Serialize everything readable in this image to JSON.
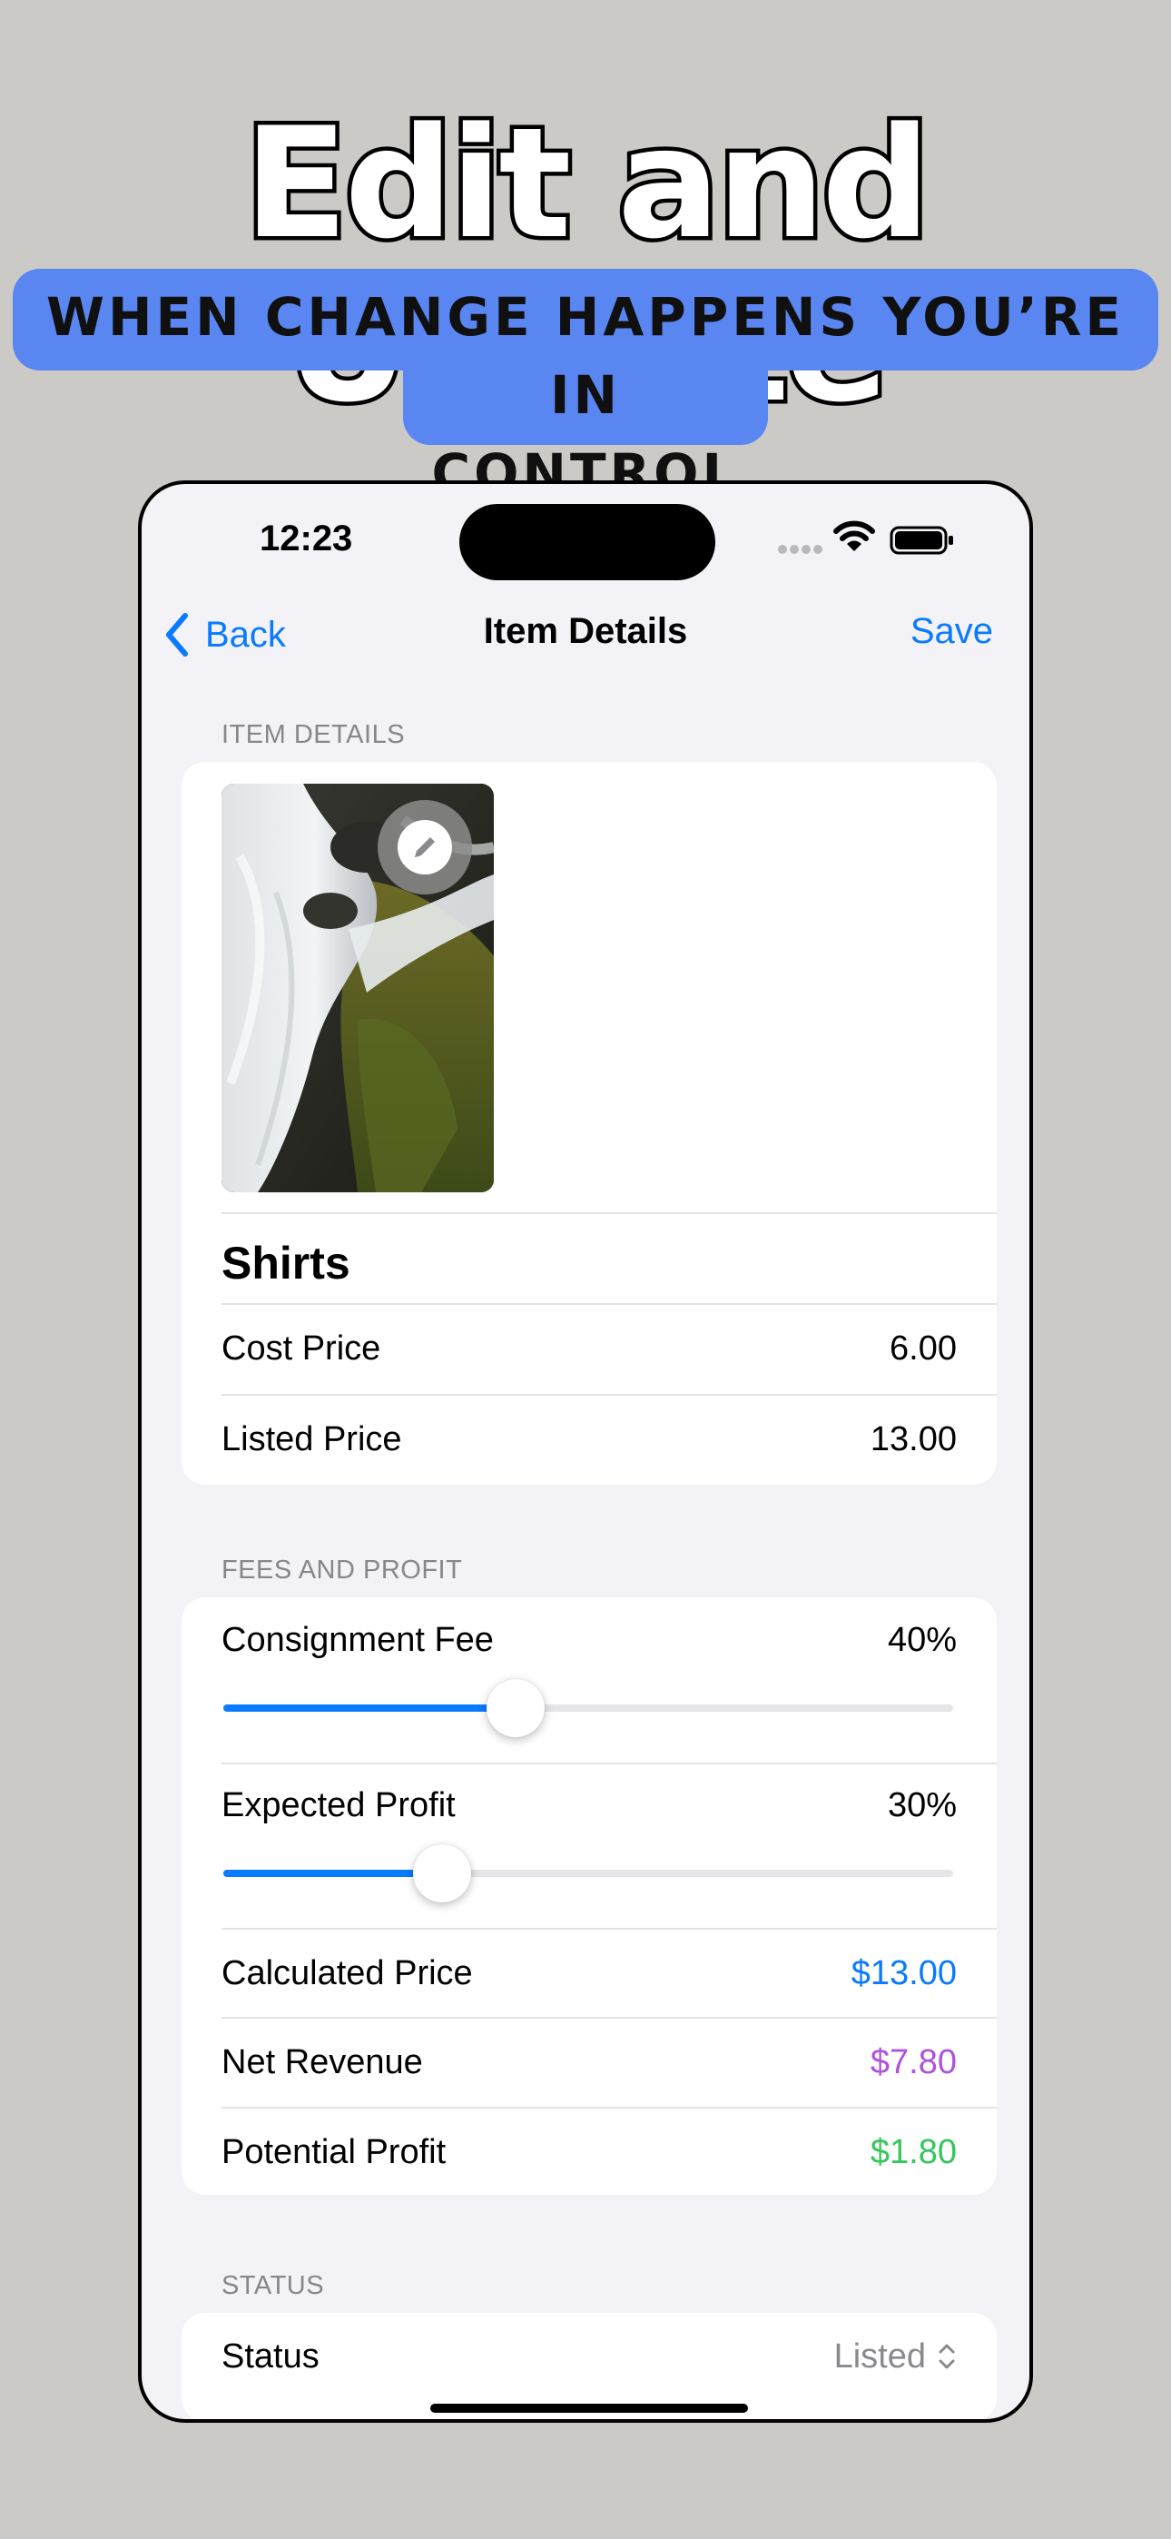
{
  "promo": {
    "headline": "Edit and Update",
    "tagline_line1": "WHEN CHANGE HAPPENS YOU’RE IN",
    "tagline_line2": "CONTROL",
    "accent_color": "#5a86f2"
  },
  "status_bar": {
    "time": "12:23",
    "icons": [
      "cellular-signal-icon",
      "wifi-icon",
      "battery-icon"
    ]
  },
  "nav": {
    "back_label": "Back",
    "title": "Item Details",
    "save_label": "Save",
    "tint_color": "#0a7aff"
  },
  "item_details": {
    "section_title": "ITEM DETAILS",
    "photo_icon": "pencil-icon",
    "name": "Shirts",
    "cost_price_label": "Cost Price",
    "cost_price_value": "6.00",
    "listed_price_label": "Listed Price",
    "listed_price_value": "13.00"
  },
  "fees_and_profit": {
    "section_title": "FEES AND PROFIT",
    "consignment_fee_label": "Consignment Fee",
    "consignment_fee_value": "40%",
    "consignment_fee_level": 0.4,
    "expected_profit_label": "Expected Profit",
    "expected_profit_value": "30%",
    "expected_profit_level": 0.3,
    "calculated_price_label": "Calculated Price",
    "calculated_price_value": "$13.00",
    "net_revenue_label": "Net Revenue",
    "net_revenue_value": "$7.80",
    "potential_profit_label": "Potential Profit",
    "potential_profit_value": "$1.80",
    "colors": {
      "calculated_price": "#0a7aff",
      "net_revenue": "#af52de",
      "potential_profit": "#34c759"
    }
  },
  "status": {
    "section_title": "STATUS",
    "label": "Status",
    "value": "Listed",
    "icon": "chevron-up-down-icon"
  }
}
